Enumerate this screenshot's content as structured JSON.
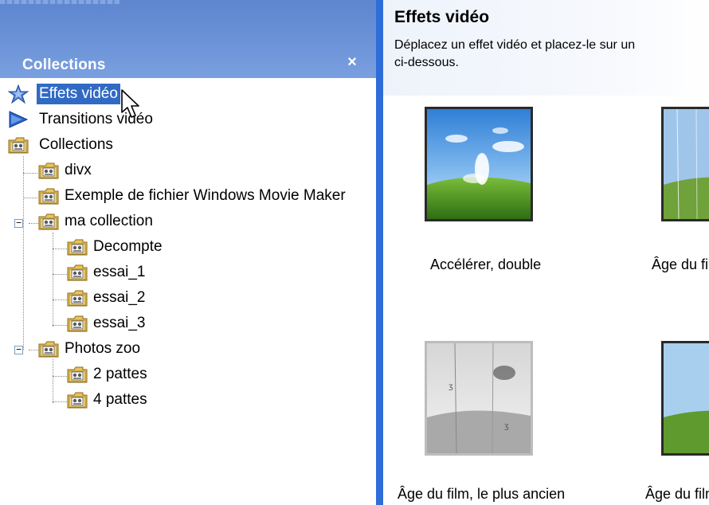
{
  "collections_panel": {
    "title": "Collections",
    "close_symbol": "×"
  },
  "tree": {
    "effects_label": "Effets vidéo",
    "transitions_label": "Transitions vidéo",
    "collections_label": "Collections",
    "divx": "divx",
    "exemple": "Exemple de fichier Windows Movie Maker",
    "ma_collection": "ma collection",
    "decompte": "Decompte",
    "essai_1": "essai_1",
    "essai_2": "essai_2",
    "essai_3": "essai_3",
    "photos_zoo": "Photos zoo",
    "deux_pattes": "2 pattes",
    "quatre_pattes": "4 pattes",
    "collapse_symbol": "−"
  },
  "effects": {
    "title": "Effets vidéo",
    "description_line1": "Déplacez un effet vidéo et placez-le sur un",
    "description_line2": "ci-dessous.",
    "items": [
      {
        "label": "Accélérer, double"
      },
      {
        "label": "Âge du film"
      },
      {
        "label": "Âge du film, le plus ancien"
      },
      {
        "label": "Âge du film"
      }
    ]
  },
  "colors": {
    "header_blue": "#6c93d8",
    "selection_blue": "#316ac5",
    "splitter_blue": "#2e6dd8"
  },
  "icons": [
    "star-icon",
    "transition-arrow-icon",
    "collection-folder-icon",
    "mouse-cursor-icon",
    "close-icon"
  ]
}
